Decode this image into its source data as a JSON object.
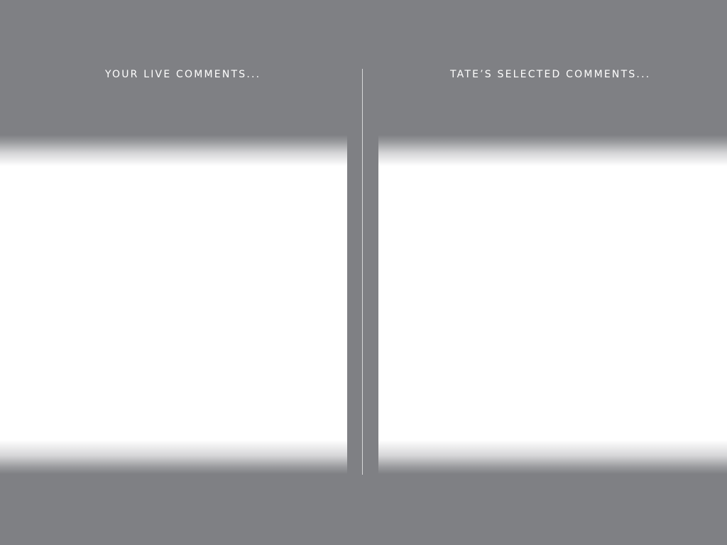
{
  "left_column": {
    "title": "YOUR LIVE COMMENTS...",
    "comments": []
  },
  "right_column": {
    "title": "TATE’S SELECTED COMMENTS...",
    "comments": []
  },
  "colors": {
    "background": "#7f8084",
    "panel": "#ffffff",
    "text": "#ffffff",
    "divider": "#d8d8da"
  }
}
